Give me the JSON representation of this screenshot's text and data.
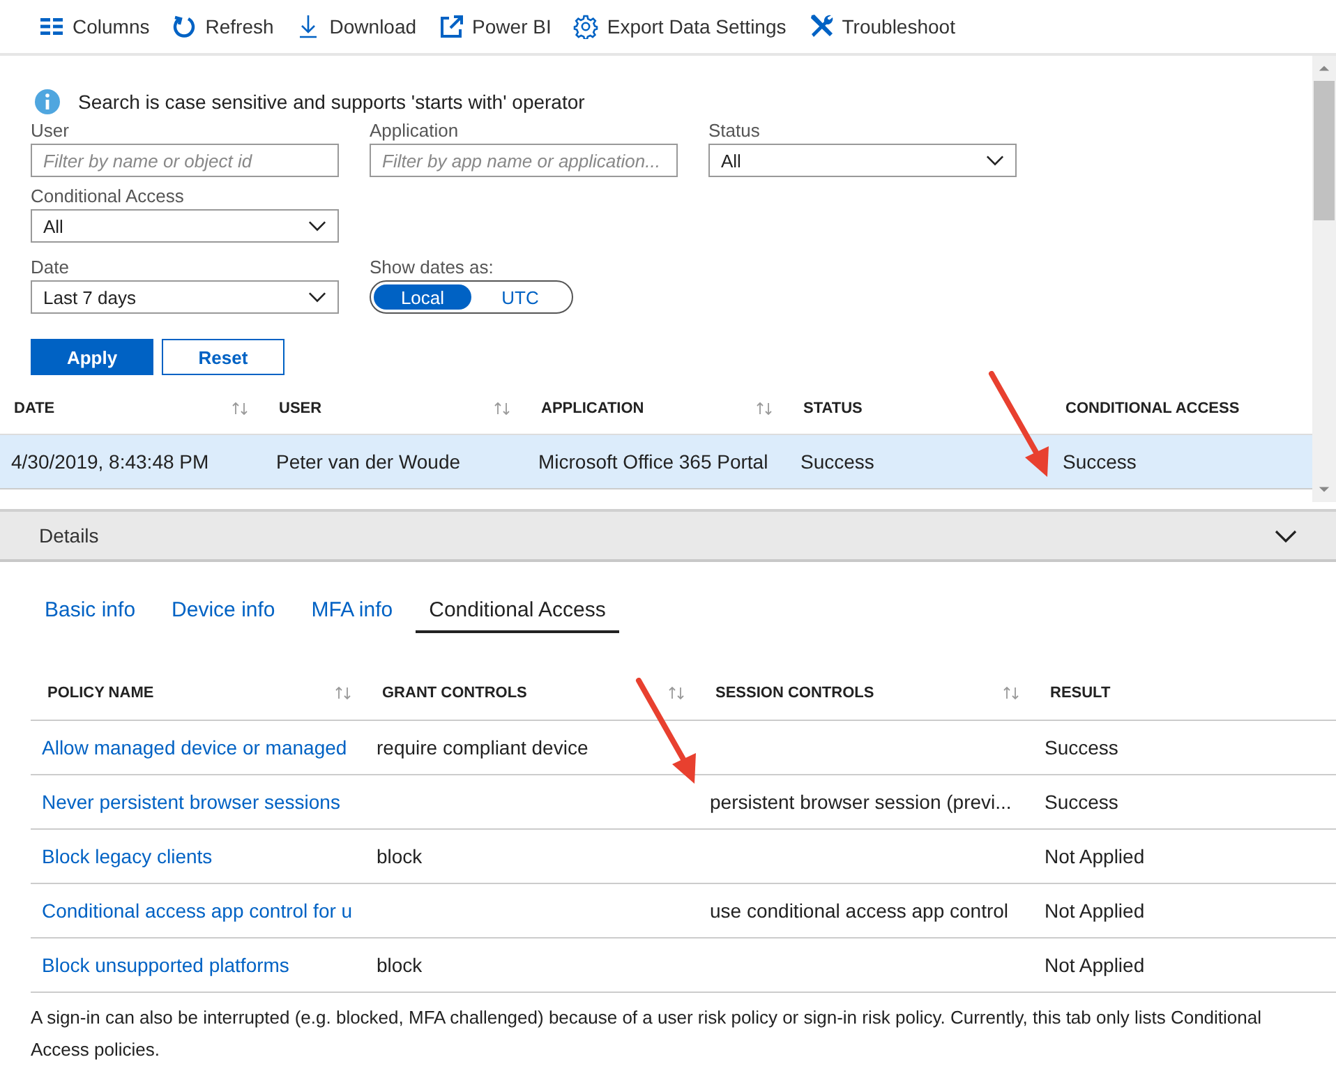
{
  "toolbar": [
    {
      "label": "Columns",
      "kind": "columns"
    },
    {
      "label": "Refresh",
      "kind": "refresh"
    },
    {
      "label": "Download",
      "kind": "download"
    },
    {
      "label": "Power BI",
      "kind": "external"
    },
    {
      "label": "Export Data Settings",
      "kind": "gear"
    },
    {
      "label": "Troubleshoot",
      "kind": "tools"
    }
  ],
  "info": "Search is case sensitive and supports 'starts with' operator",
  "filters": {
    "user": {
      "label": "User",
      "placeholder": "Filter by name or object id"
    },
    "application": {
      "label": "Application",
      "placeholder": "Filter by app name or application..."
    },
    "status": {
      "label": "Status",
      "value": "All"
    },
    "conditional_access": {
      "label": "Conditional Access",
      "value": "All"
    },
    "date": {
      "label": "Date",
      "value": "Last 7 days"
    },
    "show_dates_as": {
      "label": "Show dates as:",
      "options": [
        {
          "label": "Local",
          "selected": true
        },
        {
          "label": "UTC",
          "selected": false
        }
      ]
    }
  },
  "buttons": [
    {
      "label": "Apply",
      "kind": "primary"
    },
    {
      "label": "Reset",
      "kind": "secondary"
    }
  ],
  "signins": {
    "columns": [
      {
        "label": "DATE",
        "sortable": true
      },
      {
        "label": "USER",
        "sortable": true
      },
      {
        "label": "APPLICATION",
        "sortable": true
      },
      {
        "label": "STATUS",
        "sortable": false
      },
      {
        "label": "CONDITIONAL ACCESS",
        "sortable": false
      }
    ],
    "rows": [
      {
        "selected": true,
        "cells": [
          "4/30/2019, 8:43:48 PM",
          "Peter van der Woude",
          "Microsoft Office 365 Portal",
          "Success",
          "Success"
        ]
      }
    ]
  },
  "details": {
    "title": "Details"
  },
  "tabs": [
    {
      "label": "Basic info",
      "selected": false
    },
    {
      "label": "Device info",
      "selected": false
    },
    {
      "label": "MFA info",
      "selected": false
    },
    {
      "label": "Conditional Access",
      "selected": true
    }
  ],
  "policies": {
    "columns": [
      {
        "label": "POLICY NAME",
        "sortable": true
      },
      {
        "label": "GRANT CONTROLS",
        "sortable": true
      },
      {
        "label": "SESSION CONTROLS",
        "sortable": true
      },
      {
        "label": "RESULT",
        "sortable": false
      }
    ],
    "rows": [
      {
        "cells": [
          "Allow managed device or managed",
          "require compliant device",
          "",
          "Success"
        ]
      },
      {
        "cells": [
          "Never persistent browser sessions",
          "",
          "persistent browser session (previ...",
          "Success"
        ]
      },
      {
        "cells": [
          "Block legacy clients",
          "block",
          "",
          "Not Applied"
        ]
      },
      {
        "cells": [
          "Conditional access app control for u",
          "",
          "use conditional access app control",
          "Not Applied"
        ]
      },
      {
        "cells": [
          "Block unsupported platforms",
          "block",
          "",
          "Not Applied"
        ]
      }
    ]
  },
  "note": "A sign-in can also be interrupted (e.g. blocked, MFA challenged) because of a user risk policy or sign-in risk policy. Currently, this tab only lists Conditional Access policies."
}
